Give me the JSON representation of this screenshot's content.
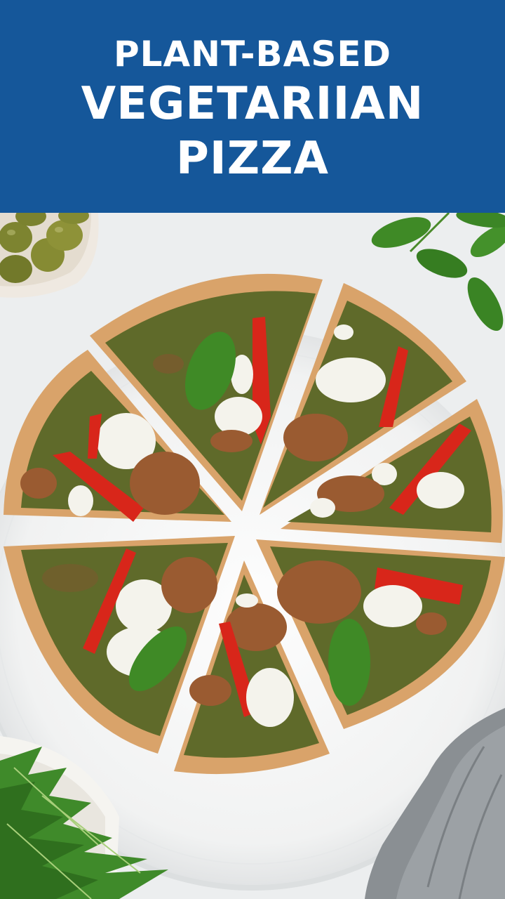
{
  "title": {
    "line1": "PLANT-BASED",
    "line2": "VEGETARIIAN",
    "line3": "PIZZA"
  },
  "colors": {
    "banner": "#15579a",
    "title_text": "#ffffff",
    "countertop": "#eceeef",
    "plate": "#f7f7f7",
    "crust": "#d9a36a",
    "pesto": "#5f6a2a",
    "pepper": "#d8261a",
    "mozzarella": "#f4f3ec",
    "basil": "#3f8a26",
    "crumble": "#9a5b31",
    "olive": "#8a8a3a",
    "napkin": "#8a8f93"
  },
  "photo": {
    "subject": "pizza-photo",
    "slices": 8,
    "props": [
      "olive-bowl",
      "basil-sprig",
      "arugula-bowl",
      "linen-napkin"
    ]
  }
}
